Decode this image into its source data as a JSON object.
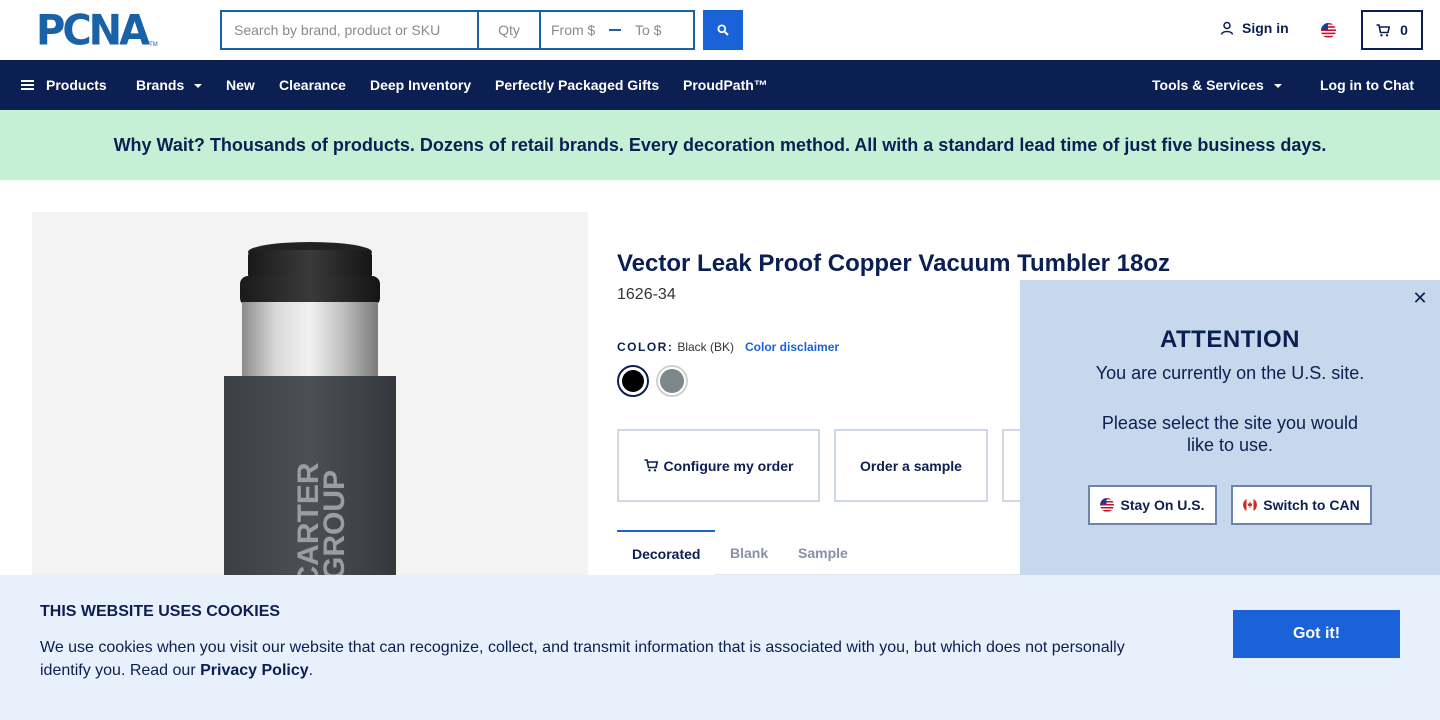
{
  "header": {
    "logo_text": "PCNA",
    "logo_tm": "TM",
    "search_placeholder": "Search by brand, product or SKU",
    "qty_placeholder": "Qty",
    "price_from": "From $",
    "price_to": "To $",
    "signin_label": "Sign in",
    "cart_count": "0"
  },
  "nav": {
    "products": "Products",
    "brands": "Brands",
    "new": "New",
    "clearance": "Clearance",
    "deep_inventory": "Deep Inventory",
    "perfectly_packaged": "Perfectly Packaged Gifts",
    "proudpath": "ProudPath™",
    "tools_services": "Tools & Services",
    "chat": "Log in to Chat"
  },
  "promo_text": "Why Wait? Thousands of products. Dozens of retail brands. Every decoration method. All with a standard lead time of just five business days.",
  "product": {
    "title": "Vector Leak Proof Copper Vacuum Tumbler 18oz",
    "sku": "1626-34",
    "color_label": "COLOR:",
    "color_value": "Black (BK)",
    "color_disclaimer": "Color disclaimer",
    "imprint_text_line1": "CARTER",
    "imprint_text_line2": "GROUP",
    "swatches": [
      {
        "name": "Black",
        "hex": "#000000"
      },
      {
        "name": "Gray",
        "hex": "#7b878a"
      }
    ],
    "configure_label": "Configure my order",
    "sample_label": "Order a sample",
    "tabs": [
      "Decorated",
      "Blank",
      "Sample"
    ]
  },
  "attention": {
    "title": "ATTENTION",
    "line1": "You are currently on the U.S. site.",
    "line2": "Please select the site you would like to use.",
    "stay_label": "Stay On U.S.",
    "switch_label": "Switch to CAN"
  },
  "cookies": {
    "title": "THIS WEBSITE USES COOKIES",
    "text": "We use cookies when you visit our website that can recognize, collect, and transmit information that is associated with you, but which does not personally identify you. Read our",
    "link": "Privacy Policy",
    "end": ".",
    "button": "Got it!"
  },
  "colors": {
    "navy": "#0b1f52",
    "brand_blue": "#1a62a8",
    "action_blue": "#1a62d8",
    "promo_green": "#c6f0d6",
    "cookie_bg": "#e7f0fb",
    "popup_bg": "#c8d8ec"
  }
}
